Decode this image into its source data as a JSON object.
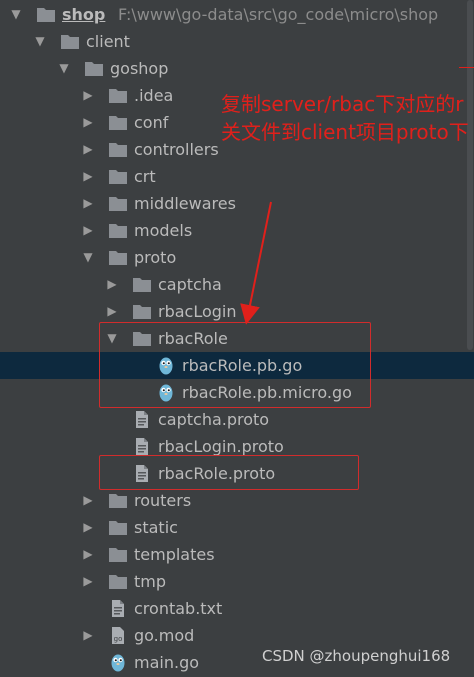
{
  "tree": {
    "root": {
      "label": "shop",
      "path": "F:\\www\\go-data\\src\\go_code\\micro\\shop"
    },
    "items": [
      {
        "id": "client",
        "label": "client",
        "type": "folder",
        "depth": 1,
        "expanded": true
      },
      {
        "id": "goshop",
        "label": "goshop",
        "type": "folder",
        "depth": 2,
        "expanded": true
      },
      {
        "id": "idea",
        "label": ".idea",
        "type": "folder",
        "depth": 3,
        "expanded": false
      },
      {
        "id": "conf",
        "label": "conf",
        "type": "folder",
        "depth": 3,
        "expanded": false
      },
      {
        "id": "controllers",
        "label": "controllers",
        "type": "folder",
        "depth": 3,
        "expanded": false
      },
      {
        "id": "crt",
        "label": "crt",
        "type": "folder",
        "depth": 3,
        "expanded": false
      },
      {
        "id": "middlewares",
        "label": "middlewares",
        "type": "folder",
        "depth": 3,
        "expanded": false
      },
      {
        "id": "models",
        "label": "models",
        "type": "folder",
        "depth": 3,
        "expanded": false
      },
      {
        "id": "proto",
        "label": "proto",
        "type": "folder",
        "depth": 3,
        "expanded": true
      },
      {
        "id": "captcha",
        "label": "captcha",
        "type": "folder",
        "depth": 4,
        "expanded": false
      },
      {
        "id": "rbacLogin",
        "label": "rbacLogin",
        "type": "folder",
        "depth": 4,
        "expanded": false
      },
      {
        "id": "rbacRole",
        "label": "rbacRole",
        "type": "folder",
        "depth": 4,
        "expanded": true
      },
      {
        "id": "rbacRole_pb_go",
        "label": "rbacRole.pb.go",
        "type": "gofile",
        "depth": 5,
        "selected": true
      },
      {
        "id": "rbacRole_pb_micro_go",
        "label": "rbacRole.pb.micro.go",
        "type": "gofile",
        "depth": 5
      },
      {
        "id": "captcha_proto",
        "label": "captcha.proto",
        "type": "file",
        "depth": 4
      },
      {
        "id": "rbacLogin_proto",
        "label": "rbacLogin.proto",
        "type": "file",
        "depth": 4
      },
      {
        "id": "rbacRole_proto",
        "label": "rbacRole.proto",
        "type": "file",
        "depth": 4
      },
      {
        "id": "routers",
        "label": "routers",
        "type": "folder",
        "depth": 3,
        "expanded": false
      },
      {
        "id": "static",
        "label": "static",
        "type": "folder",
        "depth": 3,
        "expanded": false
      },
      {
        "id": "templates",
        "label": "templates",
        "type": "folder",
        "depth": 3,
        "expanded": false
      },
      {
        "id": "tmp",
        "label": "tmp",
        "type": "folder",
        "depth": 3,
        "expanded": false
      },
      {
        "id": "crontab",
        "label": "crontab.txt",
        "type": "file",
        "depth": 3
      },
      {
        "id": "gomod",
        "label": "go.mod",
        "type": "modfile",
        "depth": 3,
        "expanded": false
      },
      {
        "id": "maingo",
        "label": "main.go",
        "type": "gofile",
        "depth": 3
      }
    ]
  },
  "annotation": {
    "line1": "复制server/rbac下对应的r",
    "line2": "关文件到client项目proto下"
  },
  "watermark": "CSDN @zhoupenghui168",
  "colors": {
    "background": "#3c3f41",
    "selected_row": "#0d293e",
    "text": "#bbbbbb",
    "folder": "#8b8f94",
    "go_gopher": "#6fb7d8",
    "annotation_red": "#e0201b"
  }
}
